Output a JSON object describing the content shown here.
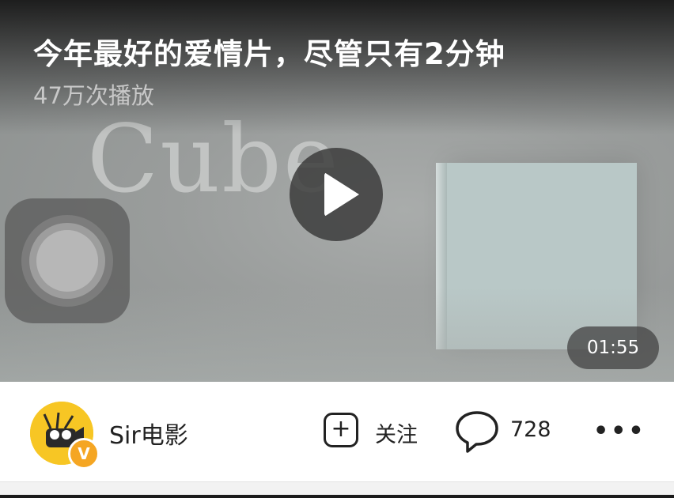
{
  "video": {
    "title": "今年最好的爱情片，尽管只有2分钟",
    "play_count": "47万次播放",
    "scene_text": "Cube",
    "duration": "01:55",
    "play_icon": "play-icon",
    "assistive_icon": "assistive-touch-icon"
  },
  "footer": {
    "author_name": "Sir电影",
    "verified_badge": "V",
    "follow_label": "关注",
    "follow_icon_glyph": "+",
    "comment_count": "728",
    "more_glyph": "•••"
  },
  "colors": {
    "avatar_yellow": "#f7c624",
    "badge_orange": "#f5a623",
    "text_dark": "#222222"
  }
}
